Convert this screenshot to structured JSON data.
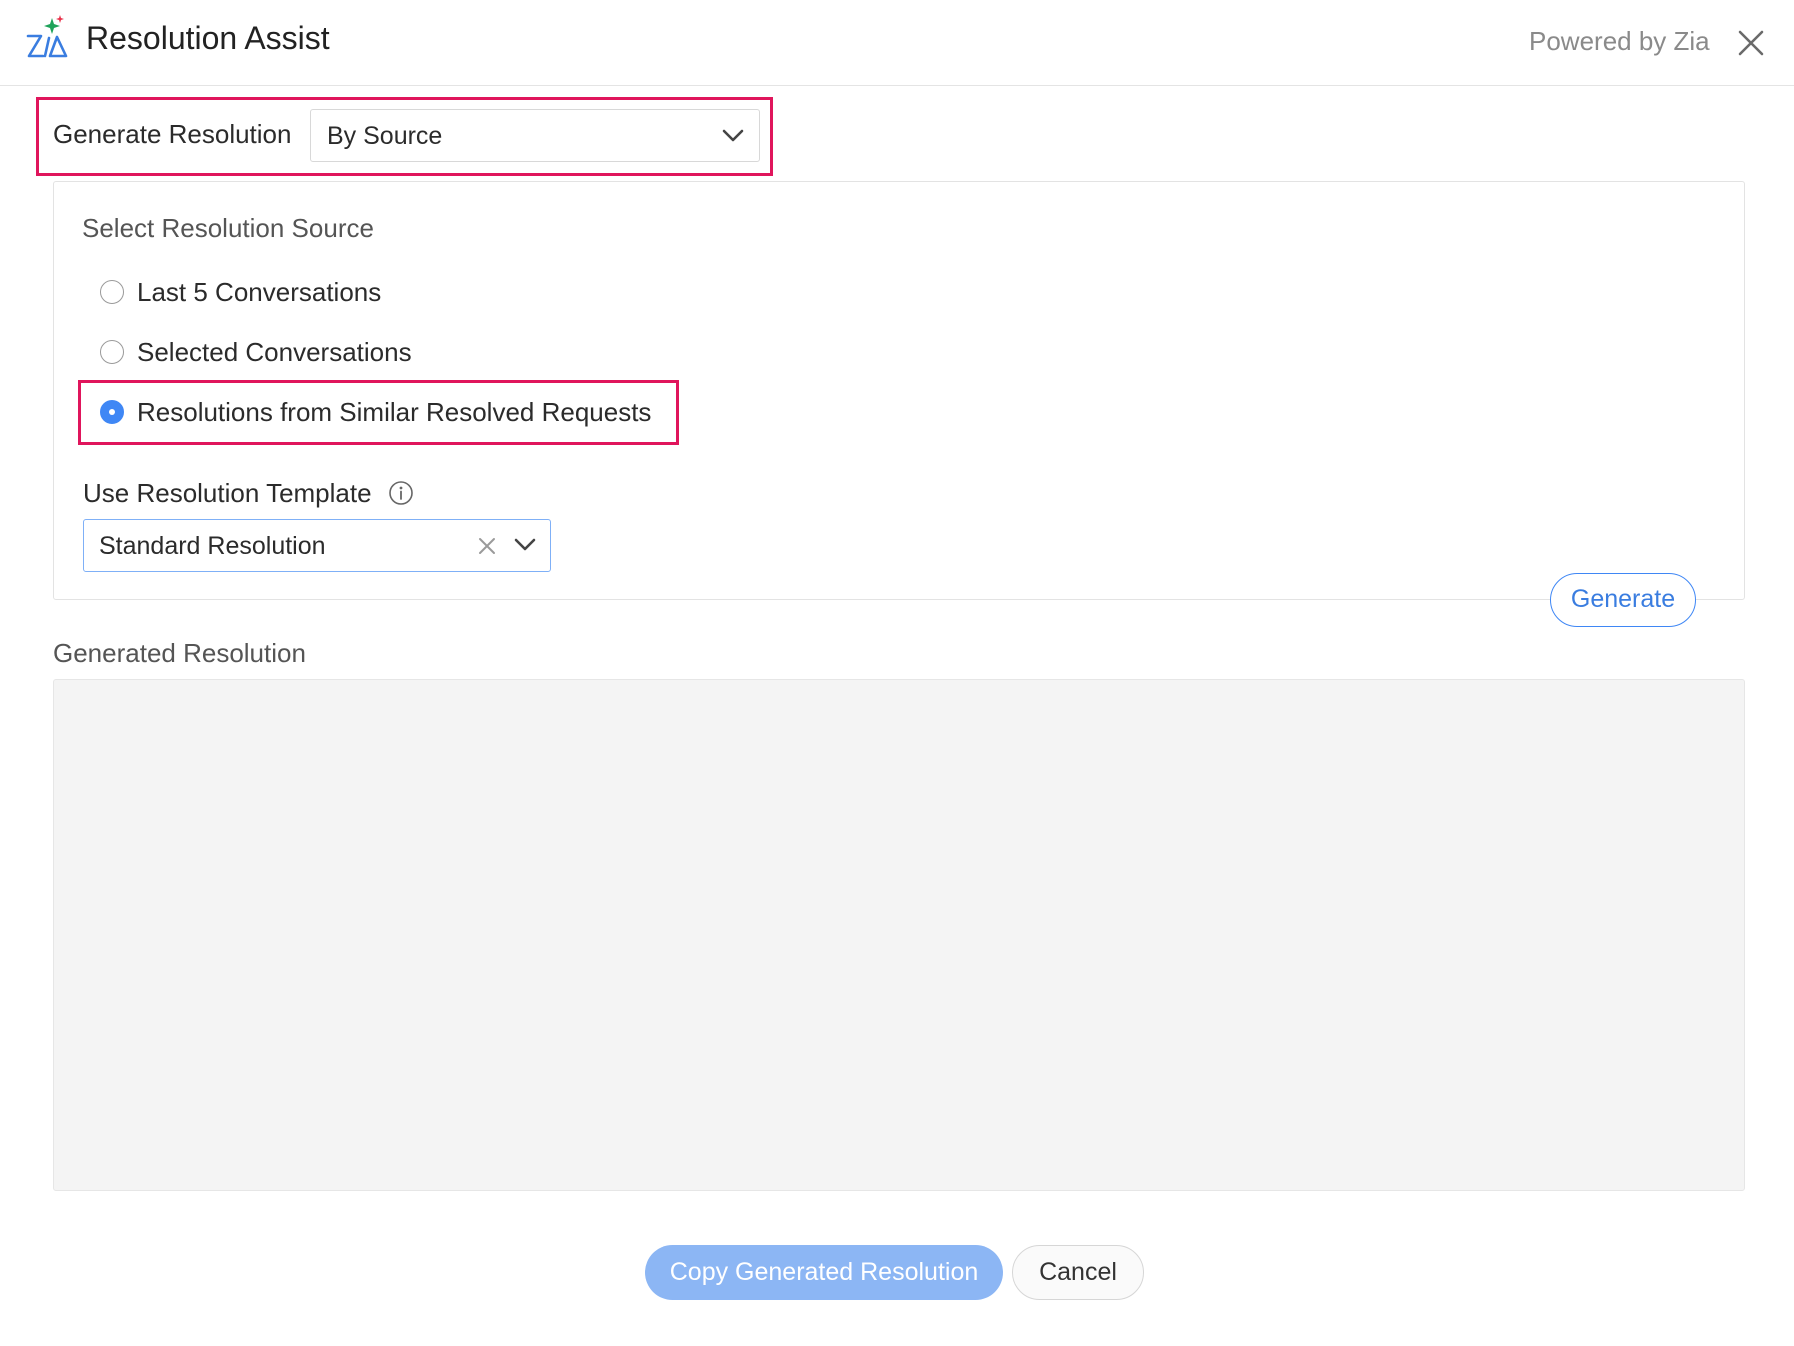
{
  "header": {
    "title": "Resolution Assist",
    "powered_by": "Powered by Zia",
    "logo_icon": "zia-logo-icon",
    "close_icon": "close-icon"
  },
  "generate": {
    "label": "Generate Resolution",
    "selected": "By Source"
  },
  "source": {
    "label": "Select Resolution Source",
    "options": [
      {
        "label": "Last 5 Conversations",
        "selected": false
      },
      {
        "label": "Selected Conversations",
        "selected": false
      },
      {
        "label": "Resolutions from Similar Resolved Requests",
        "selected": true
      }
    ]
  },
  "template": {
    "label": "Use Resolution Template",
    "selected": "Standard Resolution",
    "info_icon": "info-icon"
  },
  "generate_button": "Generate",
  "generated": {
    "label": "Generated Resolution",
    "value": ""
  },
  "footer": {
    "copy_label": "Copy Generated Resolution",
    "cancel_label": "Cancel"
  },
  "colors": {
    "accent": "#3f87f5",
    "highlight": "#e0155c",
    "copy_button_bg": "#8cb6f4"
  }
}
